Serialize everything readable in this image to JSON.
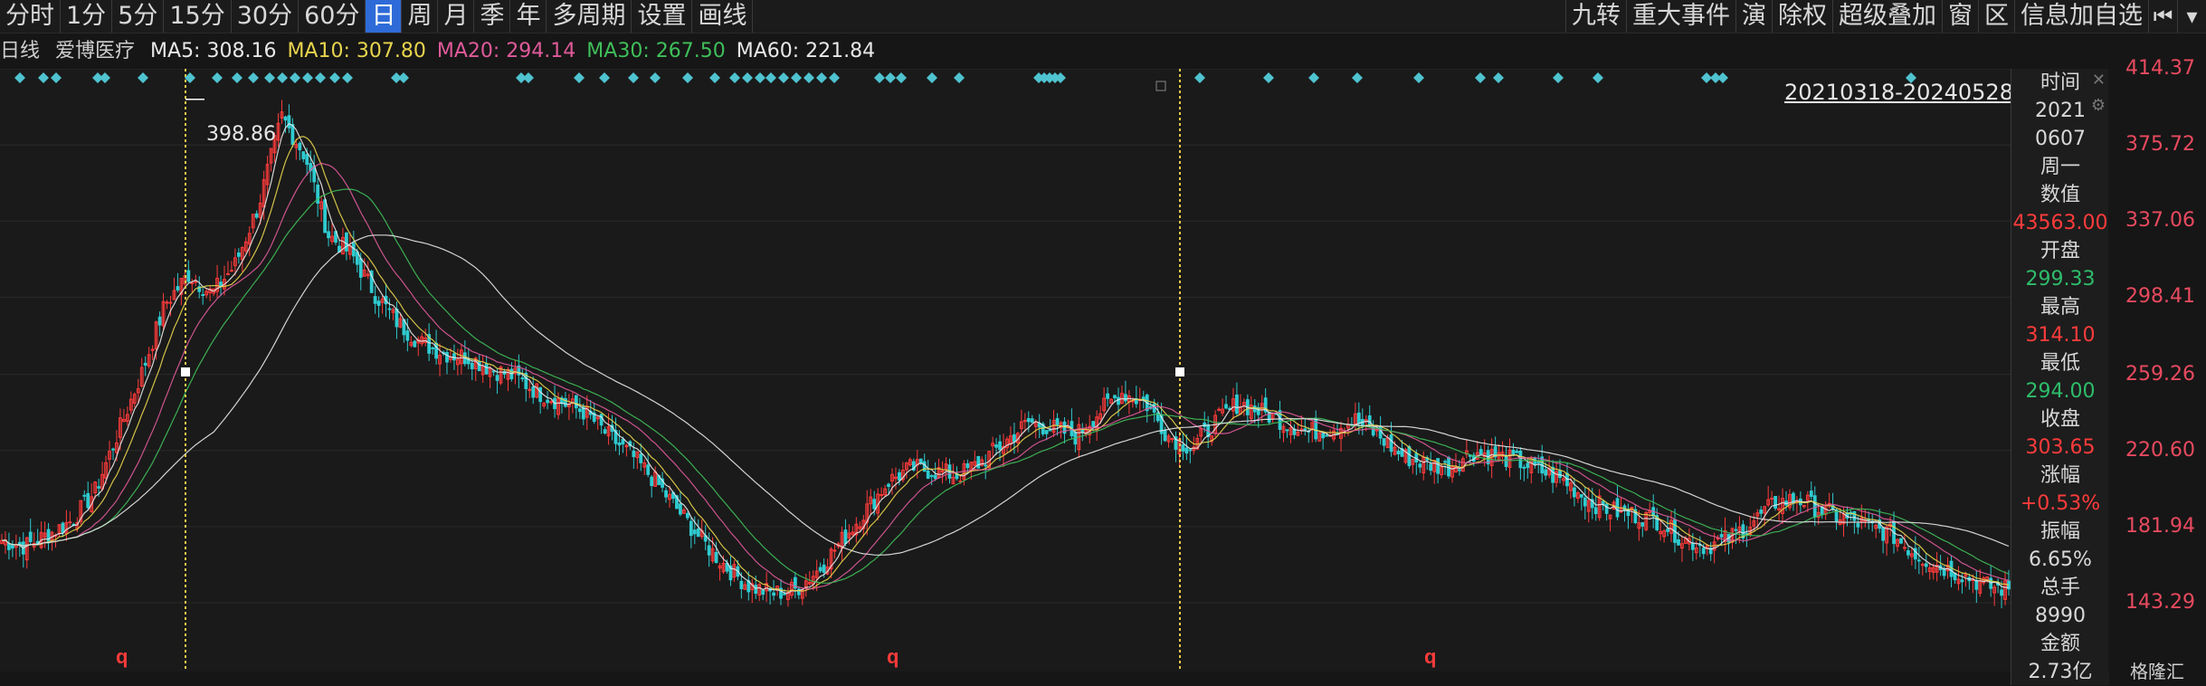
{
  "toolbar": {
    "periods": [
      "分时",
      "1分",
      "5分",
      "15分",
      "30分",
      "60分",
      "日",
      "周",
      "月",
      "季",
      "年",
      "多周期",
      "设置",
      "画线"
    ],
    "active_index": 6,
    "right_items": [
      "九转",
      "重大事件",
      "演",
      "除权",
      "超级叠加",
      "窗",
      "区",
      "信息加自选"
    ]
  },
  "ma_bar": {
    "period_label": "日线",
    "stock_name": "爱博医疗",
    "items": [
      {
        "label": "MA5:",
        "value": "308.16",
        "color": "#e8e8e8"
      },
      {
        "label": "MA10:",
        "value": "307.80",
        "color": "#e8d44d"
      },
      {
        "label": "MA20:",
        "value": "294.14",
        "color": "#e05a9a"
      },
      {
        "label": "MA30:",
        "value": "267.50",
        "color": "#3fbf5a"
      },
      {
        "label": "MA60:",
        "value": "221.84",
        "color": "#e8e8e8"
      }
    ]
  },
  "range_label": "20210318-20240528",
  "peak_label": "398.86",
  "price_axis": {
    "labels": [
      "414.37",
      "375.72",
      "337.06",
      "298.41",
      "259.26",
      "220.60",
      "181.94",
      "143.29"
    ],
    "min": 143.29,
    "max": 414.37
  },
  "info_panel": {
    "rows": [
      {
        "text": "时间",
        "tone": "white"
      },
      {
        "text": "2021",
        "tone": "white"
      },
      {
        "text": "0607",
        "tone": "white"
      },
      {
        "text": "周一",
        "tone": "white"
      },
      {
        "text": "数值",
        "tone": "white"
      },
      {
        "text": "43563.00",
        "tone": "red"
      },
      {
        "text": "开盘",
        "tone": "white"
      },
      {
        "text": "299.33",
        "tone": "green"
      },
      {
        "text": "最高",
        "tone": "white"
      },
      {
        "text": "314.10",
        "tone": "red"
      },
      {
        "text": "最低",
        "tone": "white"
      },
      {
        "text": "294.00",
        "tone": "green"
      },
      {
        "text": "收盘",
        "tone": "white"
      },
      {
        "text": "303.65",
        "tone": "red"
      },
      {
        "text": "涨幅",
        "tone": "white"
      },
      {
        "text": "+0.53%",
        "tone": "red"
      },
      {
        "text": "振幅",
        "tone": "white"
      },
      {
        "text": "6.65%",
        "tone": "white"
      },
      {
        "text": "总手",
        "tone": "white"
      },
      {
        "text": "8990",
        "tone": "white"
      },
      {
        "text": "金额",
        "tone": "white"
      },
      {
        "text": "2.73亿",
        "tone": "white"
      }
    ]
  },
  "q_marks": [
    "q",
    "q",
    "q"
  ],
  "logo": "格隆汇",
  "colors": {
    "up": "#ff3b3b",
    "down": "#2ecbd0",
    "ma5": "#e8e8e8",
    "ma10": "#e8d44d",
    "ma20": "#e05a9a",
    "ma30": "#3fbf5a",
    "ma60": "#e8e8e8",
    "marker_line": "#e8c84a",
    "diamond": "#4fc3d0"
  },
  "chart_data": {
    "type": "candlestick",
    "y_axis_range": [
      143.29,
      414.37
    ],
    "highlighted_high": 398.86,
    "close_trend": [
      175,
      172,
      178,
      185,
      200,
      230,
      260,
      295,
      310,
      300,
      315,
      345,
      390,
      370,
      330,
      320,
      300,
      285,
      275,
      270,
      268,
      262,
      258,
      250,
      245,
      240,
      228,
      218,
      205,
      190,
      175,
      162,
      152,
      148,
      150,
      160,
      175,
      190,
      205,
      212,
      210,
      208,
      215,
      225,
      235,
      232,
      228,
      240,
      250,
      245,
      228,
      222,
      235,
      245,
      240,
      235,
      230,
      232,
      236,
      228,
      218,
      214,
      212,
      220,
      218,
      215,
      210,
      205,
      195,
      190,
      188,
      185,
      176,
      172,
      176,
      184,
      194,
      196,
      190,
      186,
      182,
      178,
      168,
      162,
      158,
      152,
      150
    ]
  }
}
